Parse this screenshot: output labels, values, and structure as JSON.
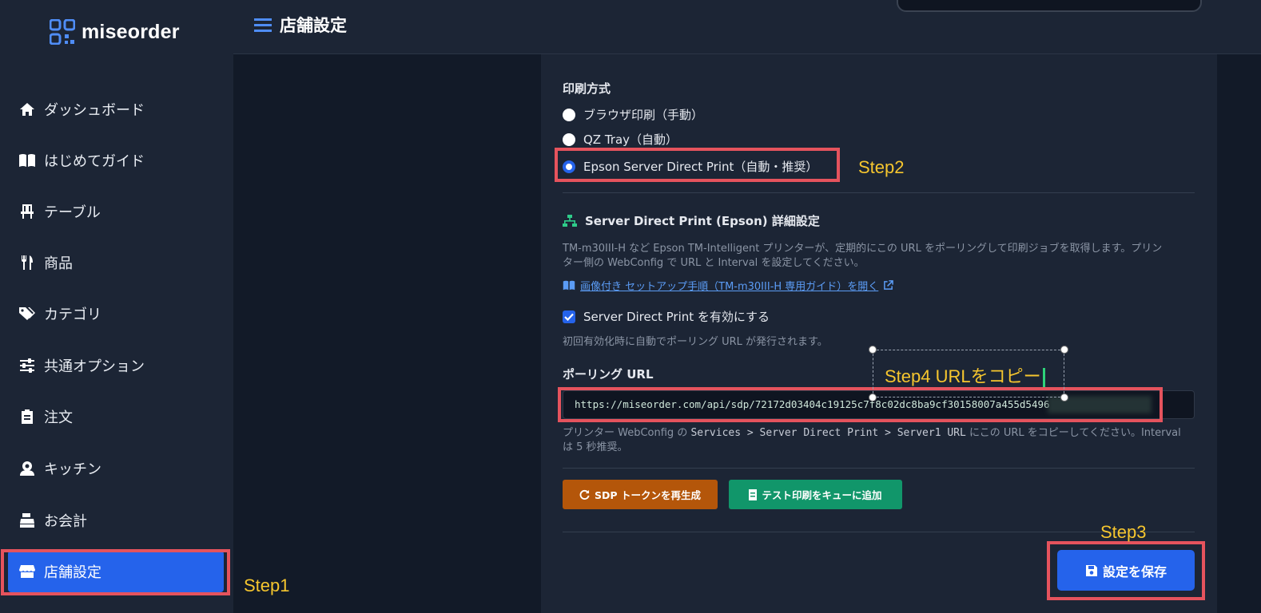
{
  "brand": {
    "name": "miseorder"
  },
  "header": {
    "title": "店舗設定"
  },
  "sidebar": {
    "items": [
      {
        "label": "ダッシュボード",
        "icon": "home-icon"
      },
      {
        "label": "はじめてガイド",
        "icon": "book-icon"
      },
      {
        "label": "テーブル",
        "icon": "chair-icon"
      },
      {
        "label": "商品",
        "icon": "utensils-icon"
      },
      {
        "label": "カテゴリ",
        "icon": "tags-icon"
      },
      {
        "label": "共通オプション",
        "icon": "sliders-icon"
      },
      {
        "label": "注文",
        "icon": "clipboard-icon"
      },
      {
        "label": "キッチン",
        "icon": "chef-icon"
      },
      {
        "label": "お会計",
        "icon": "cash-register-icon"
      },
      {
        "label": "店舗設定",
        "icon": "store-icon",
        "active": true
      }
    ]
  },
  "print_method": {
    "label": "印刷方式",
    "options": [
      {
        "label": "ブラウザ印刷（手動）",
        "checked": false
      },
      {
        "label": "QZ Tray（自動）",
        "checked": false
      },
      {
        "label": "Epson Server Direct Print（自動・推奨）",
        "checked": true
      }
    ]
  },
  "sdp": {
    "title": "Server Direct Print (Epson) 詳細設定",
    "description_line1": "TM-m30III-H など Epson TM-Intelligent プリンターが、定期的にこの URL をポーリングして印刷ジョブを取得します。プリン",
    "description_line2": "ター側の WebConfig で URL と Interval を設定してください。",
    "guide_link": "画像付き セットアップ手順（TM-m30III-H 専用ガイド）を開く",
    "enable_label": "Server Direct Print を有効にする",
    "enable_checked": true,
    "enable_hint": "初回有効化時に自動でポーリング URL が発行されます。",
    "polling_label": "ポーリング URL",
    "polling_url": "https://miseorder.com/api/sdp/72172d03404c19125c7f8c02dc8ba9cf30158007a455d5496",
    "hint_prefix": "プリンター WebConfig の ",
    "hint_path": "Services > Server Direct Print > Server1 URL",
    "hint_suffix": " にこの URL をコピーしてください。Interval",
    "hint_line2": "は 5 秒推奨。",
    "regen_button": "SDP トークンを再生成",
    "test_button": "テスト印刷をキューに追加",
    "save_button": "設定を保存"
  },
  "annotations": {
    "step1": "Step1",
    "step2": "Step2",
    "step3": "Step3",
    "step4": "Step4 URLをコピー"
  },
  "colors": {
    "accent": "#2563eb",
    "warning": "#b4560a",
    "success": "#11966a",
    "highlight": "#e5535d",
    "annotation": "#f6c62e"
  }
}
